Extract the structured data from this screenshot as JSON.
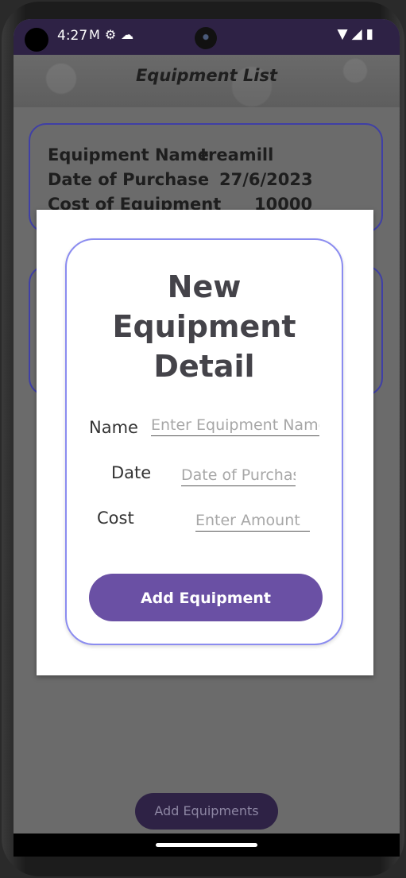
{
  "status_bar": {
    "time": "4:27",
    "left_icons": [
      "gmail-icon",
      "settings-icon",
      "cloud-icon"
    ],
    "right_icons": [
      "wifi-icon",
      "signal-icon",
      "battery-icon"
    ]
  },
  "header": {
    "title": "Equipment List"
  },
  "equipment_cards": [
    {
      "name_label": "Equipment Name",
      "name_value": "treamill",
      "date_label": "Date of Purchase",
      "date_value": "27/6/2023",
      "cost_label": "Cost of Equipment",
      "cost_value": "10000"
    }
  ],
  "bottom_button": {
    "label": "Add Equipments"
  },
  "dialog": {
    "title": "New Equipment Detail",
    "fields": {
      "name": {
        "label": "Name",
        "placeholder": "Enter Equipment Name",
        "value": ""
      },
      "date": {
        "label": "Date",
        "placeholder": "Date of Purchase",
        "value": ""
      },
      "cost": {
        "label": "Cost",
        "placeholder": "Enter Amount",
        "value": ""
      }
    },
    "submit_label": "Add Equipment"
  },
  "colors": {
    "status_bar": "#2e2245",
    "dialog_border": "#8b8cf0",
    "primary_button": "#6a50a4",
    "card_border": "#3f3fa6",
    "dim_overlay": "#6b6b6b"
  }
}
